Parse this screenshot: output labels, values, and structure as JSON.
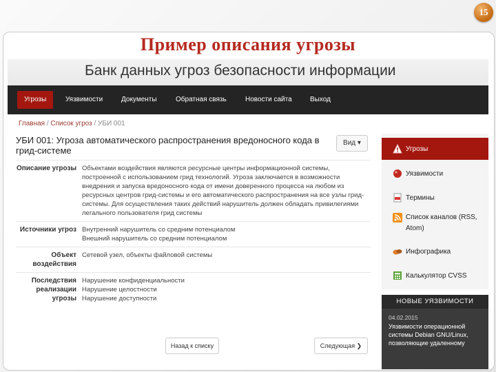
{
  "slide": {
    "number": "15",
    "title": "Пример описания угрозы"
  },
  "site": {
    "banner_title": "Банк данных угроз безопасности информации",
    "nav": [
      {
        "label": "Угрозы",
        "active": true
      },
      {
        "label": "Уязвимости"
      },
      {
        "label": "Документы"
      },
      {
        "label": "Обратная связь"
      },
      {
        "label": "Новости сайта"
      },
      {
        "label": "Выход"
      }
    ]
  },
  "breadcrumb": {
    "home": "Главная",
    "list": "Список угроз",
    "current": "УБИ 001",
    "sep": "/"
  },
  "threat": {
    "title": "УБИ 001: Угроза автоматического распространения вредоносного кода в грид-системе",
    "view_button": "Вид ▾",
    "rows": [
      {
        "label": "Описание угрозы",
        "value": "Объектами воздействия являются ресурсные центры информационной системы, построенной с использованием грид технологий. Угроза заключается в возможности внедрения и запуска вредоносного кода от имени доверенного процесса на любом из ресурсных центров грид-системы и его автоматического распространения на все узлы грид-системы. Для осуществления таких действий нарушитель должен обладать привилегиями легального пользователя грид системы"
      },
      {
        "label": "Источники угроз",
        "value": "Внутренний нарушитель со средним потенциалом\nВнешний нарушитель со средним потенциалом"
      },
      {
        "label": "Объект воздействия",
        "value": "Сетевой узел, объекты файловой системы"
      },
      {
        "label": "Последствия реализации угрозы",
        "value": "Нарушение конфиденциальности\nНарушение целостности\nНарушение доступности"
      }
    ],
    "back_button": "Назад к списку",
    "next_button": "Следующая ❯"
  },
  "sidebar": {
    "items": [
      {
        "label": "Угрозы",
        "icon": "warning-icon",
        "active": true
      },
      {
        "label": "Уязвимости",
        "icon": "bug-icon"
      },
      {
        "label": "Термины",
        "icon": "pdf-icon"
      },
      {
        "label": "Список каналов (RSS, Atom)",
        "icon": "rss-icon"
      },
      {
        "label": "Инфографика",
        "icon": "infographic-icon"
      },
      {
        "label": "Калькулятор CVSS",
        "icon": "calculator-icon"
      }
    ]
  },
  "news": {
    "header": "НОВЫЕ УЯЗВИМОСТИ",
    "date": "04.02.2015",
    "text": "Уязвимости операционной системы Debian GNU/Linux, позволяющие удаленному"
  },
  "colors": {
    "accent": "#a3170f",
    "navbar": "#242424",
    "title": "#b5291f"
  }
}
